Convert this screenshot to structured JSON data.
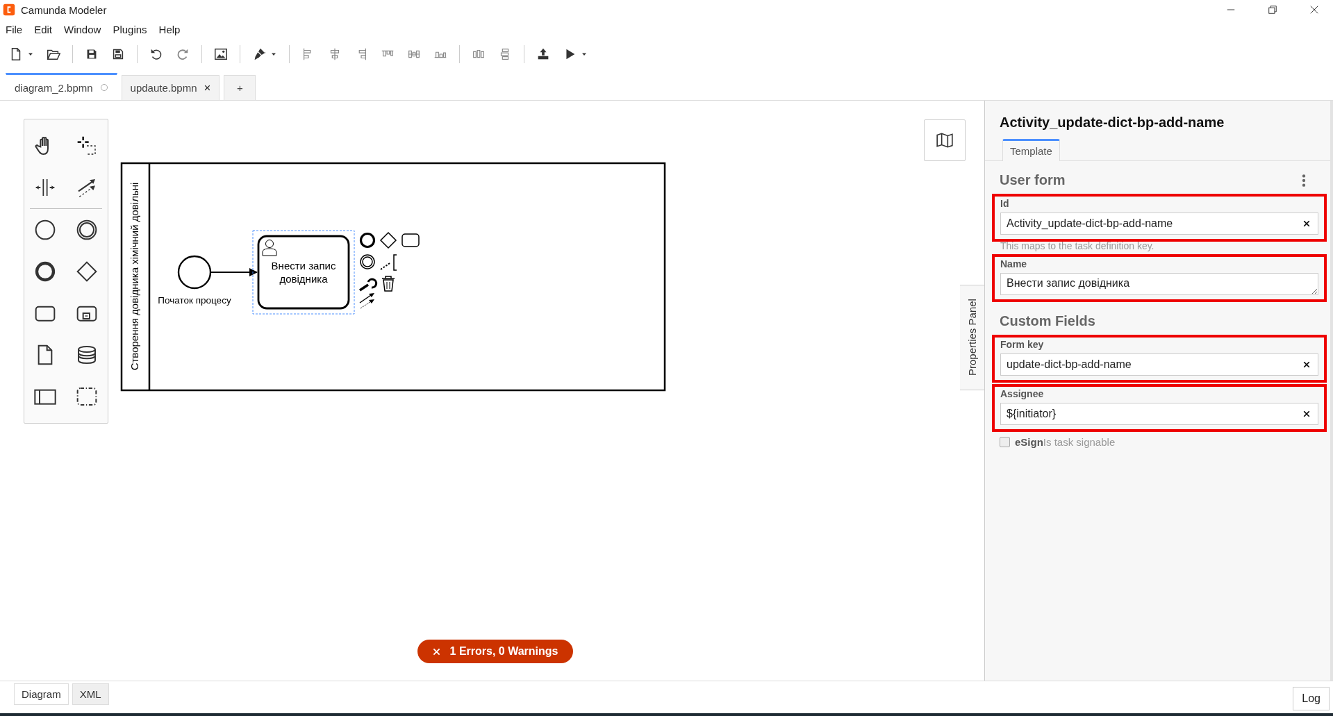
{
  "window": {
    "title": "Camunda Modeler"
  },
  "menu": [
    "File",
    "Edit",
    "Window",
    "Plugins",
    "Help"
  ],
  "tabs": [
    {
      "label": "diagram_2.bpmn",
      "selected": true,
      "kind": "unsaved"
    },
    {
      "label": "updaute.bpmn",
      "selected": false,
      "kind": "closable",
      "close": "×"
    }
  ],
  "new_tab": "+",
  "diagram": {
    "lane_label": "Створення довідника хімічний довільні",
    "start_event": "Початок процесу",
    "task": "Внести запис довідника",
    "task_selected": true
  },
  "properties_toggle": "Properties Panel",
  "properties": {
    "title": "Activity_update-dict-bp-add-name",
    "tabs": [
      {
        "label": "Template",
        "selected": true
      }
    ],
    "groups": [
      {
        "title": "User form",
        "actions_menu": true,
        "fields": [
          {
            "kind": "text",
            "label": "Id",
            "value": "Activity_update-dict-bp-add-name",
            "clearable": true,
            "highlighted": true,
            "description": "This maps to the task definition key."
          },
          {
            "kind": "textarea",
            "label": "Name",
            "value": "Внести запис довідника",
            "highlighted": true
          }
        ]
      },
      {
        "title": "Custom Fields",
        "actions_menu": false,
        "fields": [
          {
            "kind": "text",
            "label": "Form key",
            "value": "update-dict-bp-add-name",
            "clearable": true,
            "highlighted": true
          },
          {
            "kind": "text",
            "label": "Assignee",
            "value": "${initiator}",
            "clearable": true,
            "highlighted": true
          },
          {
            "kind": "checkbox",
            "label": "eSign",
            "description": "Is task signable",
            "checked": false
          }
        ]
      }
    ]
  },
  "status": {
    "text": "1 Errors, 0 Warnings",
    "kind": "error"
  },
  "bottom_tabs": [
    {
      "label": "Diagram",
      "selected": true
    },
    {
      "label": "XML",
      "selected": false
    }
  ],
  "log_button": "Log"
}
